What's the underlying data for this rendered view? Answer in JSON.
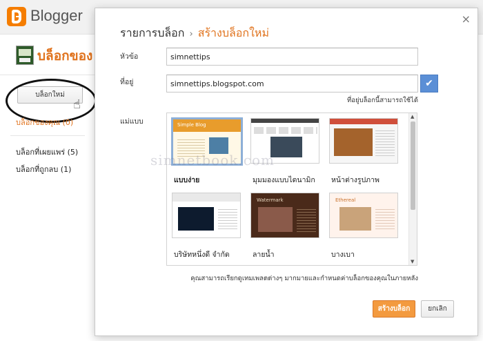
{
  "app": {
    "name": "Blogger",
    "brand_color": "#f57d00",
    "accent_color": "#e0721c"
  },
  "sidebar": {
    "blog_of_label": "บล็อกของ ส",
    "new_blog_button": "บล็อกใหม่",
    "my_blogs": "บล็อกของคุณ (0)",
    "published_blogs": "บล็อกที่เผยแพร่ (5)",
    "deleted_blogs": "บล็อกที่ถูกลบ (1)"
  },
  "dialog": {
    "breadcrumb": {
      "parent": "รายการบล็อก",
      "separator": "›",
      "current": "สร้างบล็อกใหม่"
    },
    "close_icon": "×",
    "title_label": "หัวข้อ",
    "title_value": "simnettips",
    "address_label": "ที่อยู่",
    "address_value": "simnettips.blogspot.com",
    "address_check": "✔",
    "address_hint": "ที่อยู่บล็อกนี้สามารถใช้ได้",
    "template_label": "แม่แบบ",
    "templates": [
      {
        "name": "แบบง่าย",
        "caption": "Simple Blog",
        "selected": true
      },
      {
        "name": "มุมมองแบบไดนามิก",
        "selected": false
      },
      {
        "name": "หน้าต่างรูปภาพ",
        "selected": false
      },
      {
        "name": "บริษัทหนึ่งดี จำกัด",
        "selected": false
      },
      {
        "name": "ลายน้ำ",
        "caption": "Watermark",
        "selected": false
      },
      {
        "name": "บางเบา",
        "caption": "Ethereal",
        "selected": false
      }
    ],
    "watermark": "simnetbook.com",
    "footer_note": "คุณสามารถเรียกดูเทมเพลตต่างๆ มากมายและกำหนดค่าบล็อกของคุณในภายหลัง",
    "create_button": "สร้างบล็อก",
    "cancel_button": "ยกเลิก"
  }
}
